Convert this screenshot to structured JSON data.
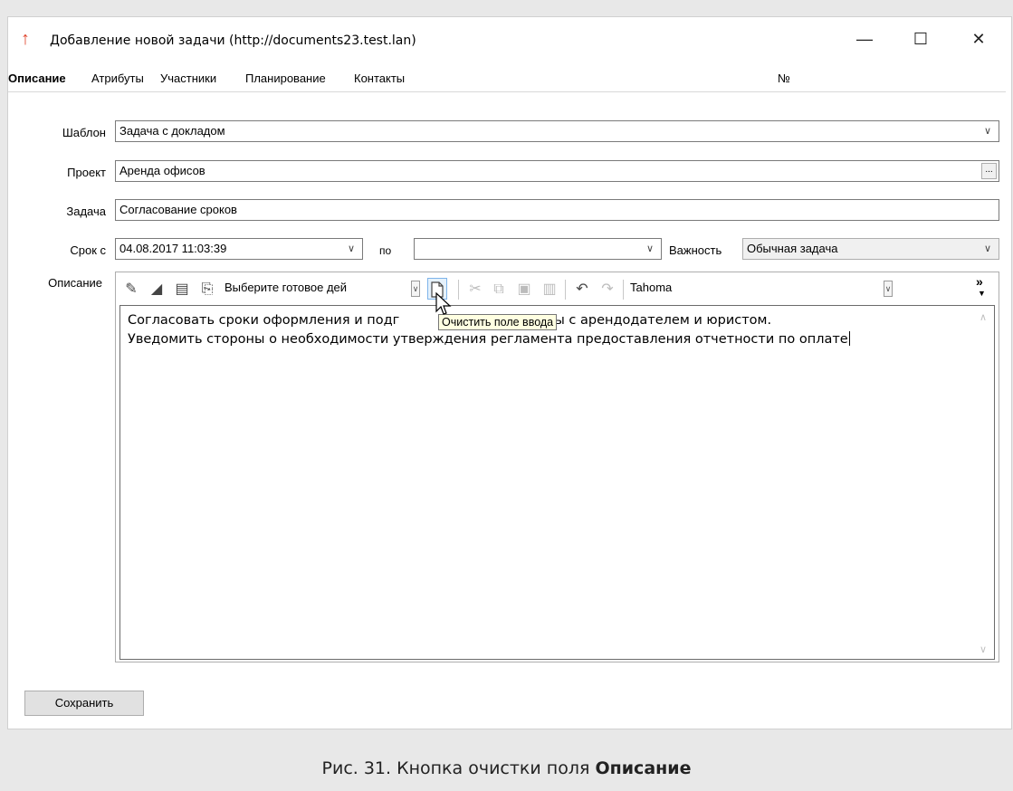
{
  "window": {
    "title": "Добавление новой задачи (http://documents23.test.lan)",
    "minimize": "—",
    "maximize": "☐",
    "close": "✕"
  },
  "tabs": [
    {
      "label": "Описание",
      "active": true
    },
    {
      "label": "Атрибуты",
      "active": false
    },
    {
      "label": "Участники",
      "active": false
    },
    {
      "label": "Планирование",
      "active": false
    },
    {
      "label": "Контакты",
      "active": false
    }
  ],
  "number_label": "№",
  "form": {
    "template_label": "Шаблон",
    "template_value": "Задача с докладом",
    "project_label": "Проект",
    "project_value": "Аренда офисов",
    "project_button": "...",
    "task_label": "Задача",
    "task_value": "Согласование сроков",
    "date_from_label": "Срок с",
    "date_from_value": "04.08.2017 11:03:39",
    "date_to_label": "по",
    "date_to_value": "",
    "importance_label": "Важность",
    "importance_value": "Обычная задача",
    "description_label": "Описание"
  },
  "editor": {
    "ready_action_placeholder": "Выберите готовое дей",
    "font_name": "Tahoma",
    "more_button": "»",
    "tooltip": "Очистить поле ввода",
    "line1_start": "Согласовать сроки оформления и подг",
    "line1_end": " аренды с арендодателем и юристом.",
    "line2": "Уведомить стороны о необходимости утверждения регламента предоставления отчетности по оплате"
  },
  "save_button": "Сохранить",
  "caption": {
    "prefix": "Рис. 31. Кнопка очистки поля ",
    "bold": "Описание"
  },
  "colors": {
    "app_icon": "#e0432b",
    "tooltip_bg": "#ffffe1",
    "hover_border": "#7eb4ea"
  }
}
